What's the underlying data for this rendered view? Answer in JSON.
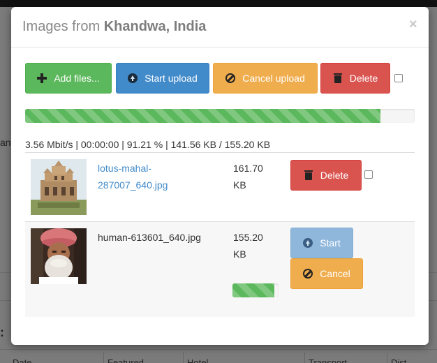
{
  "background": {
    "left_text": "an",
    "dots": ":",
    "columns": [
      "Date",
      "Featured",
      "Hotel",
      "Transport",
      "Dist"
    ]
  },
  "modal": {
    "title_prefix": "Images from",
    "title_location": "Khandwa, India",
    "close_symbol": "×"
  },
  "toolbar": {
    "add_files": "Add files...",
    "start_upload": "Start upload",
    "cancel_upload": "Cancel upload",
    "delete": "Delete",
    "select_all_checked": false
  },
  "global_progress": {
    "percent": 91.21,
    "stats": "3.56 Mbit/s | 00:00:00 | 91.21 % | 141.56 KB / 155.20 KB"
  },
  "files": [
    {
      "name": "lotus-mahal-287007_640.jpg",
      "name_line1": "lotus-mahal-",
      "name_line2": "287007_640.jpg",
      "size_value": "161.70",
      "size_unit": "KB",
      "delete_label": "Delete",
      "checked": false
    },
    {
      "name": "human-613601_640.jpg",
      "size_value": "155.20",
      "size_unit": "KB",
      "progress_percent": 91,
      "start_label": "Start",
      "cancel_label": "Cancel"
    }
  ],
  "colors": {
    "green": "#5cb85c",
    "blue": "#428bca",
    "orange": "#f0ad4e",
    "red": "#d9534f",
    "link": "#428bca"
  }
}
